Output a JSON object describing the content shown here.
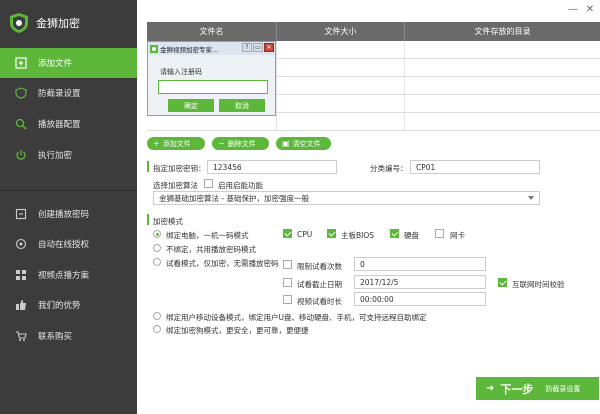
{
  "app": {
    "title": "金狮加密"
  },
  "sidebar": {
    "items": [
      {
        "label": "添加文件",
        "icon": "add-file-icon"
      },
      {
        "label": "防截录设置",
        "icon": "shield-icon"
      },
      {
        "label": "播放器配置",
        "icon": "search-icon"
      },
      {
        "label": "执行加密",
        "icon": "power-icon"
      },
      {
        "label": "创建播放密码",
        "icon": "key-icon"
      },
      {
        "label": "自动在线授权",
        "icon": "target-icon"
      },
      {
        "label": "视频点播方案",
        "icon": "grid-icon"
      },
      {
        "label": "我们的优势",
        "icon": "thumb-icon"
      },
      {
        "label": "联系购买",
        "icon": "cart-icon"
      }
    ]
  },
  "window": {
    "minimize": "—",
    "close": "✕"
  },
  "table": {
    "headers": [
      "文件名",
      "文件大小",
      "文件存放的目录"
    ],
    "rows": 5
  },
  "dialog": {
    "title": "金狮视频加密专家...",
    "label": "请输入注册码",
    "input_value": "",
    "ok": "确定",
    "cancel": "取消",
    "btn_help": "?",
    "btn_min": "▭",
    "btn_close": "✕"
  },
  "actions": {
    "add": "添加文件",
    "delete": "删除文件",
    "clear": "清空文件"
  },
  "form": {
    "key_label": "指定加密密钥：",
    "key_value": "123456",
    "category_label": "分类编号：",
    "category_value": "CP01",
    "algo_label": "选择加密算法",
    "enhance_label": "启用启能功能",
    "algo_value": "金狮基础加密算法 - 基础保护，加密强度一般",
    "mode_title": "加密模式",
    "mode_bind": "绑定电脑，一机一码模式",
    "cpu": "CPU",
    "board": "主板BIOS",
    "disk": "硬盘",
    "nic": "网卡",
    "mode_unbind": "不绑定，共用播放密码模式",
    "mode_trial": "试看模式，仅加密，无需播放密码",
    "limit_times_label": "限制试看次数",
    "limit_times_value": "0",
    "expire_label": "试看截止日期",
    "expire_value": "2017/12/5",
    "net_time_label": "互联网时间校验",
    "duration_label": "视频试看时长",
    "duration_value": "00:00:00",
    "mode_mobile": "绑定用户移动设备模式，绑定用户U盘、移动硬盘、手机，可支持远程自助绑定",
    "mode_dongle": "绑定加密狗模式，更安全，更可靠，更便捷"
  },
  "next": {
    "label": "下一步",
    "sub": "防截录设置"
  },
  "colors": {
    "accent": "#5db73a",
    "sidebar": "#3c3c3c"
  }
}
